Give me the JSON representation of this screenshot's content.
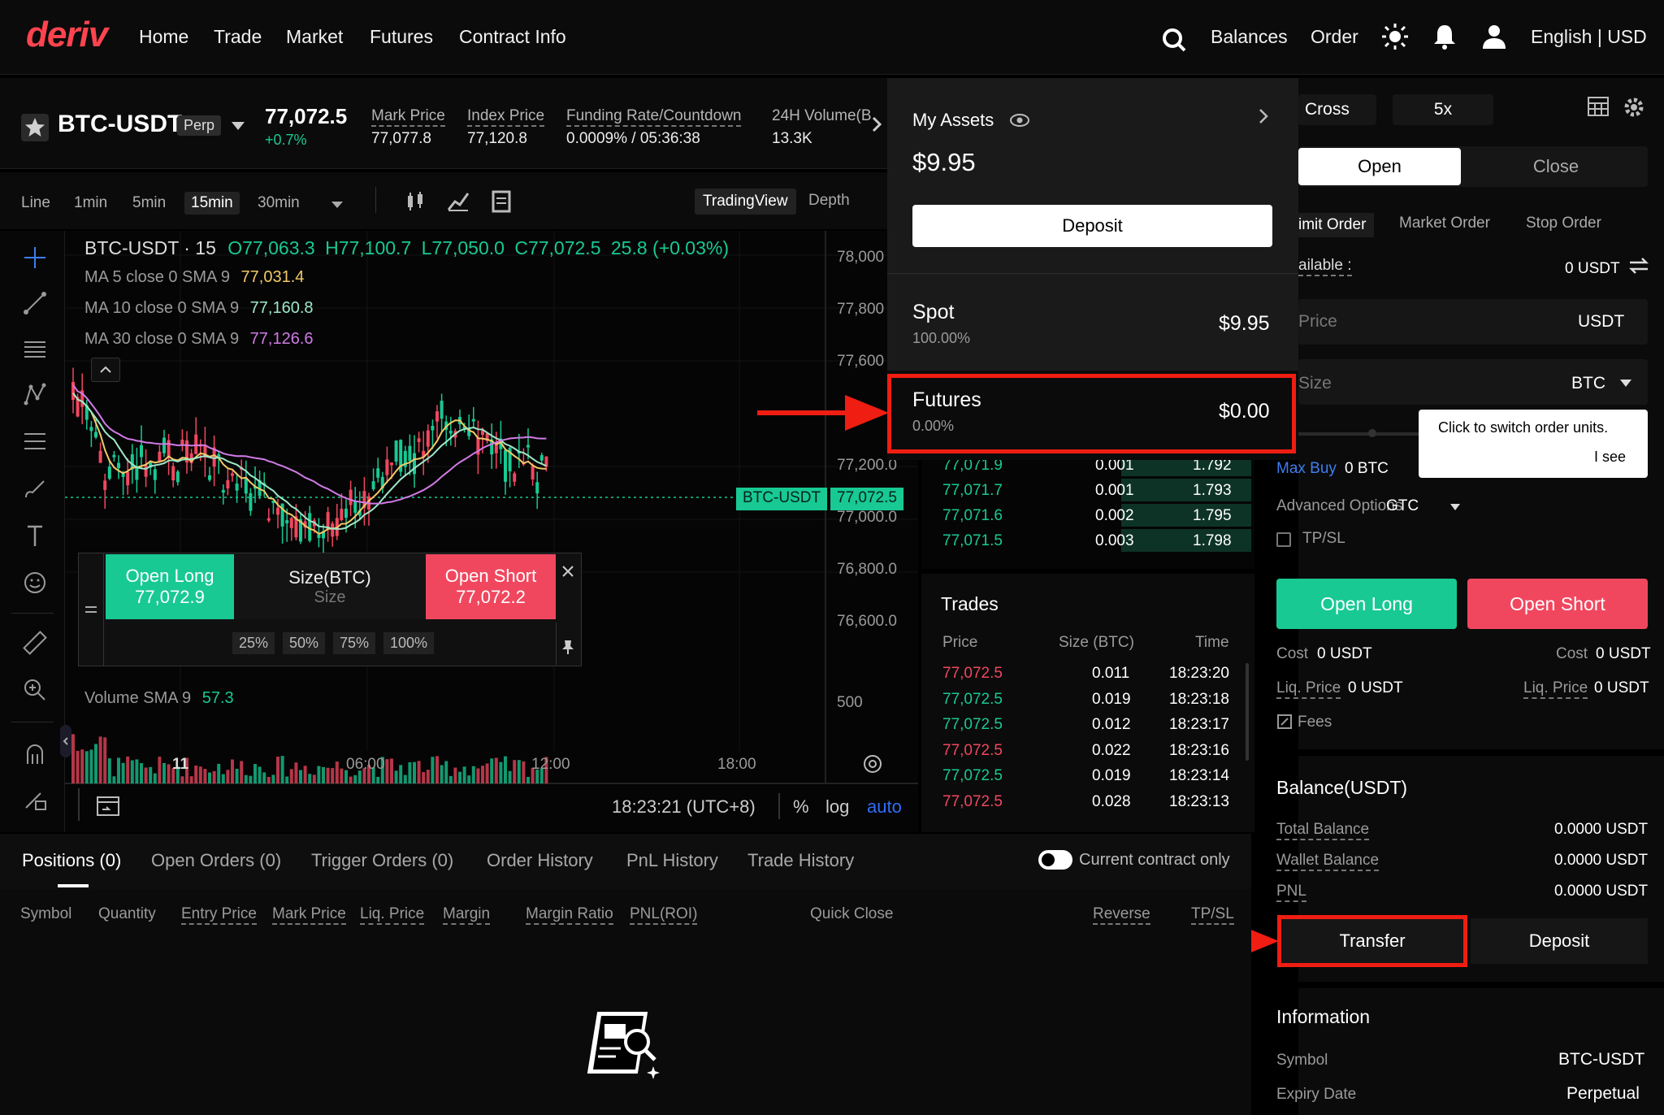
{
  "nav": {
    "logo": "deriv",
    "links": [
      "Home",
      "Trade",
      "Market",
      "Futures",
      "Contract Info"
    ],
    "right": {
      "balances": "Balances",
      "order": "Order",
      "lang": "English | USD"
    }
  },
  "symbol": {
    "name": "BTC-USDT",
    "badge": "Perp",
    "price": "77,072.5",
    "change": "+0.7%",
    "mark_label": "Mark Price",
    "mark_value": "77,077.8",
    "index_label": "Index Price",
    "index_value": "77,120.8",
    "funding_label": "Funding Rate/Countdown",
    "funding_value": "0.0009% / 05:36:38",
    "vol_label": "24H Volume(B",
    "vol_value": "13.3K"
  },
  "toolbar": {
    "timeframes": [
      "Line",
      "1min",
      "5min",
      "15min",
      "30min"
    ],
    "active": "15min",
    "views": [
      "TradingView",
      "Depth"
    ]
  },
  "chart": {
    "legend_title": "BTC-USDT · 15",
    "ohlc": {
      "o": "O77,063.3",
      "h": "H77,100.7",
      "l": "L77,050.0",
      "c": "C77,072.5",
      "chg": "25.8 (+0.03%)"
    },
    "ma5_label": "MA 5 close 0 SMA 9",
    "ma5_value": "77,031.4",
    "ma10_label": "MA 10 close 0 SMA 9",
    "ma10_value": "77,160.8",
    "ma30_label": "MA 30 close 0 SMA 9",
    "ma30_value": "77,126.6",
    "yticks": [
      "78,000",
      "77,800",
      "77,600",
      "77,200.0",
      "77,000.0",
      "76,800.0",
      "76,600.0"
    ],
    "price_tag_label": "BTC-USDT",
    "price_tag_value": "77,072.5",
    "volume_label": "Volume SMA 9",
    "volume_value": "57.3",
    "volume_tick": "500",
    "xticks": [
      "11",
      "06:00",
      "12:00",
      "18:00"
    ],
    "time": "18:23:21 (UTC+8)",
    "pct": "%",
    "log": "log",
    "auto": "auto",
    "colors": {
      "up": "#18c993",
      "down": "#f0475f",
      "ma5": "#f3c969",
      "ma10": "#9ee8c8",
      "ma30": "#d17be6"
    }
  },
  "quick_trade": {
    "long_label": "Open Long",
    "long_price": "77,072.9",
    "size_label": "Size(BTC)",
    "size_placeholder": "Size",
    "short_label": "Open Short",
    "short_price": "77,072.2",
    "pcts": [
      "25%",
      "50%",
      "75%",
      "100%"
    ]
  },
  "orderbook": {
    "rows": [
      {
        "price": "77,071.9",
        "size": "0.001",
        "total": "1.792"
      },
      {
        "price": "77,071.7",
        "size": "0.001",
        "total": "1.793"
      },
      {
        "price": "77,071.6",
        "size": "0.002",
        "total": "1.795"
      },
      {
        "price": "77,071.5",
        "size": "0.003",
        "total": "1.798"
      }
    ]
  },
  "trades": {
    "title": "Trades",
    "headers": [
      "Price",
      "Size (BTC)",
      "Time"
    ],
    "rows": [
      {
        "price": "77,072.5",
        "size": "0.011",
        "time": "18:23:20",
        "side": "sell"
      },
      {
        "price": "77,072.5",
        "size": "0.019",
        "time": "18:23:18",
        "side": "buy"
      },
      {
        "price": "77,072.5",
        "size": "0.012",
        "time": "18:23:17",
        "side": "buy"
      },
      {
        "price": "77,072.5",
        "size": "0.022",
        "time": "18:23:16",
        "side": "sell"
      },
      {
        "price": "77,072.5",
        "size": "0.019",
        "time": "18:23:14",
        "side": "buy"
      },
      {
        "price": "77,072.5",
        "size": "0.028",
        "time": "18:23:13",
        "side": "sell"
      }
    ]
  },
  "assets": {
    "title": "My Assets",
    "total": "$9.95",
    "deposit": "Deposit",
    "spot_label": "Spot",
    "spot_pct": "100.00%",
    "spot_value": "$9.95",
    "futures_label": "Futures",
    "futures_pct": "0.00%",
    "futures_value": "$0.00"
  },
  "order_panel": {
    "margin_mode": "Cross",
    "leverage": "5x",
    "tab_open": "Open",
    "tab_close": "Close",
    "order_types": [
      "imit Order",
      "Market Order",
      "Stop Order"
    ],
    "available_label": "ailable :",
    "available_value": "0 USDT",
    "price_placeholder": "Price",
    "price_unit": "USDT",
    "size_placeholder": "Size",
    "size_unit": "BTC",
    "tooltip_text": "Click to switch order units.",
    "tooltip_btn": "I see",
    "max_buy_label": "Max Buy",
    "max_buy_value": "0 BTC",
    "advanced_label": "Advanced Options",
    "advanced_value": "GTC",
    "tpsl": "TP/SL",
    "open_long": "Open Long",
    "open_short": "Open Short",
    "cost_label": "Cost",
    "cost_long": "0 USDT",
    "cost_short": "0 USDT",
    "liq_label": "Liq. Price",
    "liq_long": "0 USDT",
    "liq_short": "0 USDT",
    "fees": "Fees"
  },
  "balance": {
    "title": "Balance(USDT)",
    "rows": [
      {
        "label": "Total Balance",
        "value": "0.0000 USDT"
      },
      {
        "label": "Wallet Balance",
        "value": "0.0000 USDT"
      },
      {
        "label": "PNL",
        "value": "0.0000 USDT"
      }
    ],
    "transfer": "Transfer",
    "deposit": "Deposit"
  },
  "information": {
    "title": "Information",
    "rows": [
      {
        "label": "Symbol",
        "value": "BTC-USDT"
      },
      {
        "label": "Expiry Date",
        "value": "Perpetual"
      }
    ]
  },
  "bottom": {
    "tabs": [
      "Positions (0)",
      "Open Orders (0)",
      "Trigger Orders (0)",
      "Order History",
      "PnL History",
      "Trade History"
    ],
    "toggle_label": "Current contract only",
    "columns": [
      "Symbol",
      "Quantity",
      "Entry Price",
      "Mark Price",
      "Liq. Price",
      "Margin",
      "Margin Ratio",
      "PNL(ROI)",
      "Quick Close",
      "Reverse",
      "TP/SL"
    ]
  }
}
